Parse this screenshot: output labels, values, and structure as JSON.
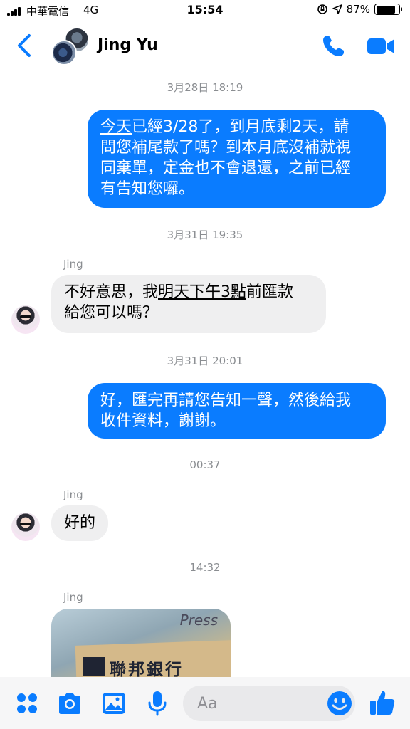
{
  "status_bar": {
    "carrier": "中華電信",
    "network": "4G",
    "time": "15:54",
    "battery": "87%",
    "battery_level": 0.87
  },
  "header": {
    "contact_name": "Jing Yu"
  },
  "messages": [
    {
      "type": "timestamp",
      "text": "3月28日 18:19"
    },
    {
      "type": "outgoing",
      "text": "今天已經3/28了，到月底剩2天，請問您補尾款了嗎？到本月底沒補就視同棄單，定金也不會退還，之前已經有告知您囉。",
      "lines": [
        "今天",
        "已經3/28了，到月底剩2天，請",
        "問您補尾款了嗎？到本月底沒補就視",
        "同棄單，定金也不會退還，之前已經",
        "有告知您囉。"
      ]
    },
    {
      "type": "timestamp",
      "text": "3月31日 19:35"
    },
    {
      "type": "incoming",
      "sender": "Jing",
      "text": "不好意思，我明天下午3點前匯款給您可以嗎？",
      "lines": [
        "不好意思，我",
        "明天下午3點",
        "前匯款",
        "給您可以嗎？"
      ]
    },
    {
      "type": "timestamp",
      "text": "3月31日 20:01"
    },
    {
      "type": "outgoing",
      "text": "好，匯完再請您告知一聲，然後給我收件資料，謝謝。",
      "lines": [
        "好，匯完再請您告知一聲，然後給我",
        "收件資料，謝謝。"
      ]
    },
    {
      "type": "timestamp",
      "text": "00:37"
    },
    {
      "type": "incoming",
      "sender": "Jing",
      "text": "好的"
    },
    {
      "type": "timestamp",
      "text": "14:32"
    },
    {
      "type": "incoming-photo",
      "sender": "Jing",
      "photo_text": "Press",
      "photo_logo": "聯邦銀行"
    }
  ],
  "composer": {
    "placeholder": "Aa"
  },
  "icons": {
    "back": "chevron-left-icon",
    "call": "phone-icon",
    "video": "video-camera-icon",
    "more": "four-dots-icon",
    "camera": "camera-icon",
    "gallery": "photo-icon",
    "voice": "microphone-icon",
    "emoji": "emoji-icon",
    "like": "thumbs-up-icon"
  },
  "colors": {
    "accent": "#0a7cff",
    "outgoing_bubble": "#0a7cff",
    "incoming_bubble": "#efeff0",
    "timestamp_text": "#8a8d91"
  }
}
